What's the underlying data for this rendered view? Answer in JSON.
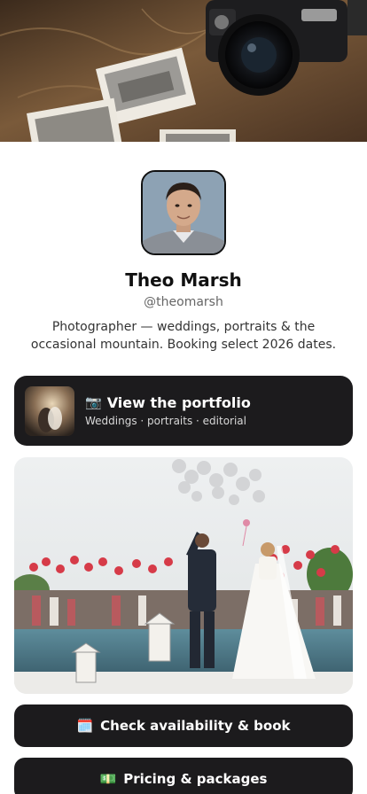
{
  "profile": {
    "name": "Theo Marsh",
    "handle": "@theomarsh",
    "bio": "Photographer — weddings, portraits & the occasional mountain. Booking select 2026 dates."
  },
  "links": {
    "portfolio": {
      "emoji": "📷",
      "title": "View the portfolio",
      "subtitle": "Weddings · portraits · editorial"
    },
    "book": {
      "emoji": "🗓️",
      "label": "Check availability & book"
    },
    "pricing": {
      "emoji": "💵",
      "label": "Pricing & packages"
    }
  },
  "colors": {
    "card_bg": "#1c1b1d",
    "text_primary": "#111111",
    "text_muted": "#666666"
  }
}
